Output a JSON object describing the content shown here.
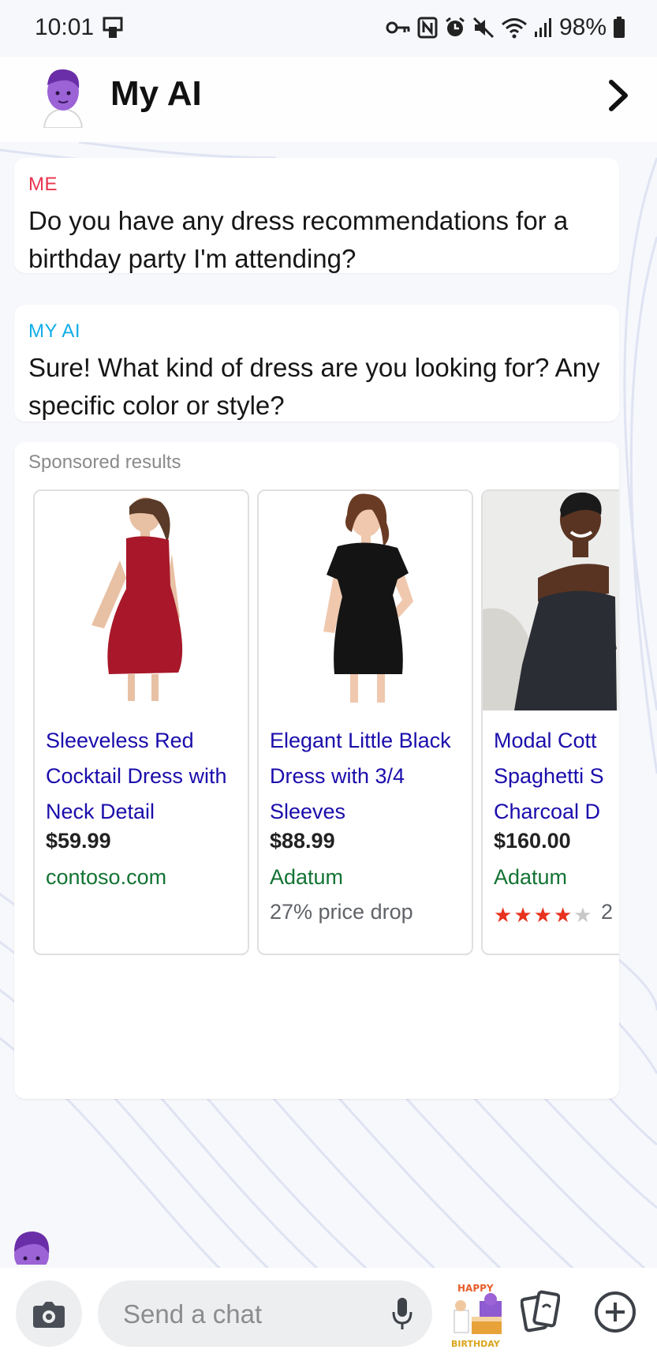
{
  "status_bar": {
    "time": "10:01",
    "battery": "98%",
    "icons": [
      "screen-mirror-icon",
      "vpn-key-icon",
      "nfc-icon",
      "alarm-icon",
      "mute-icon",
      "wifi-icon",
      "signal-icon",
      "battery-icon"
    ]
  },
  "header": {
    "title": "My AI",
    "avatar_icon": "bitmoji-avatar-icon",
    "action_icon": "chevron-right-icon"
  },
  "messages": [
    {
      "sender": "ME",
      "text": "Do you have any dress recommendations for a birthday party I'm attending?"
    },
    {
      "sender": "MY AI",
      "text": "Sure! What kind of dress are you looking for? Any specific color or style?"
    }
  ],
  "sponsored": {
    "label": "Sponsored results",
    "products": [
      {
        "title": "Sleeveless Red Cocktail Dress with Neck Detail",
        "price": "$59.99",
        "seller": "contoso.com",
        "extra": ""
      },
      {
        "title": "Elegant Little Black Dress with 3/4 Sleeves",
        "price": "$88.99",
        "seller": "Adatum",
        "extra": "27% price drop"
      },
      {
        "title": "Modal Cott Spaghetti S Charcoal D",
        "price": "$160.00",
        "seller": "Adatum",
        "rating": 4,
        "rating_max": 5,
        "rating_count": "2"
      }
    ]
  },
  "input_bar": {
    "placeholder": "Send a chat",
    "sticker_text_top": "HAPPY",
    "sticker_text_bottom": "BIRTHDAY"
  },
  "colors": {
    "me": "#e8344e",
    "ai": "#0fade8",
    "link": "#1a0dab",
    "seller": "#137333",
    "star": "#e8321f"
  }
}
